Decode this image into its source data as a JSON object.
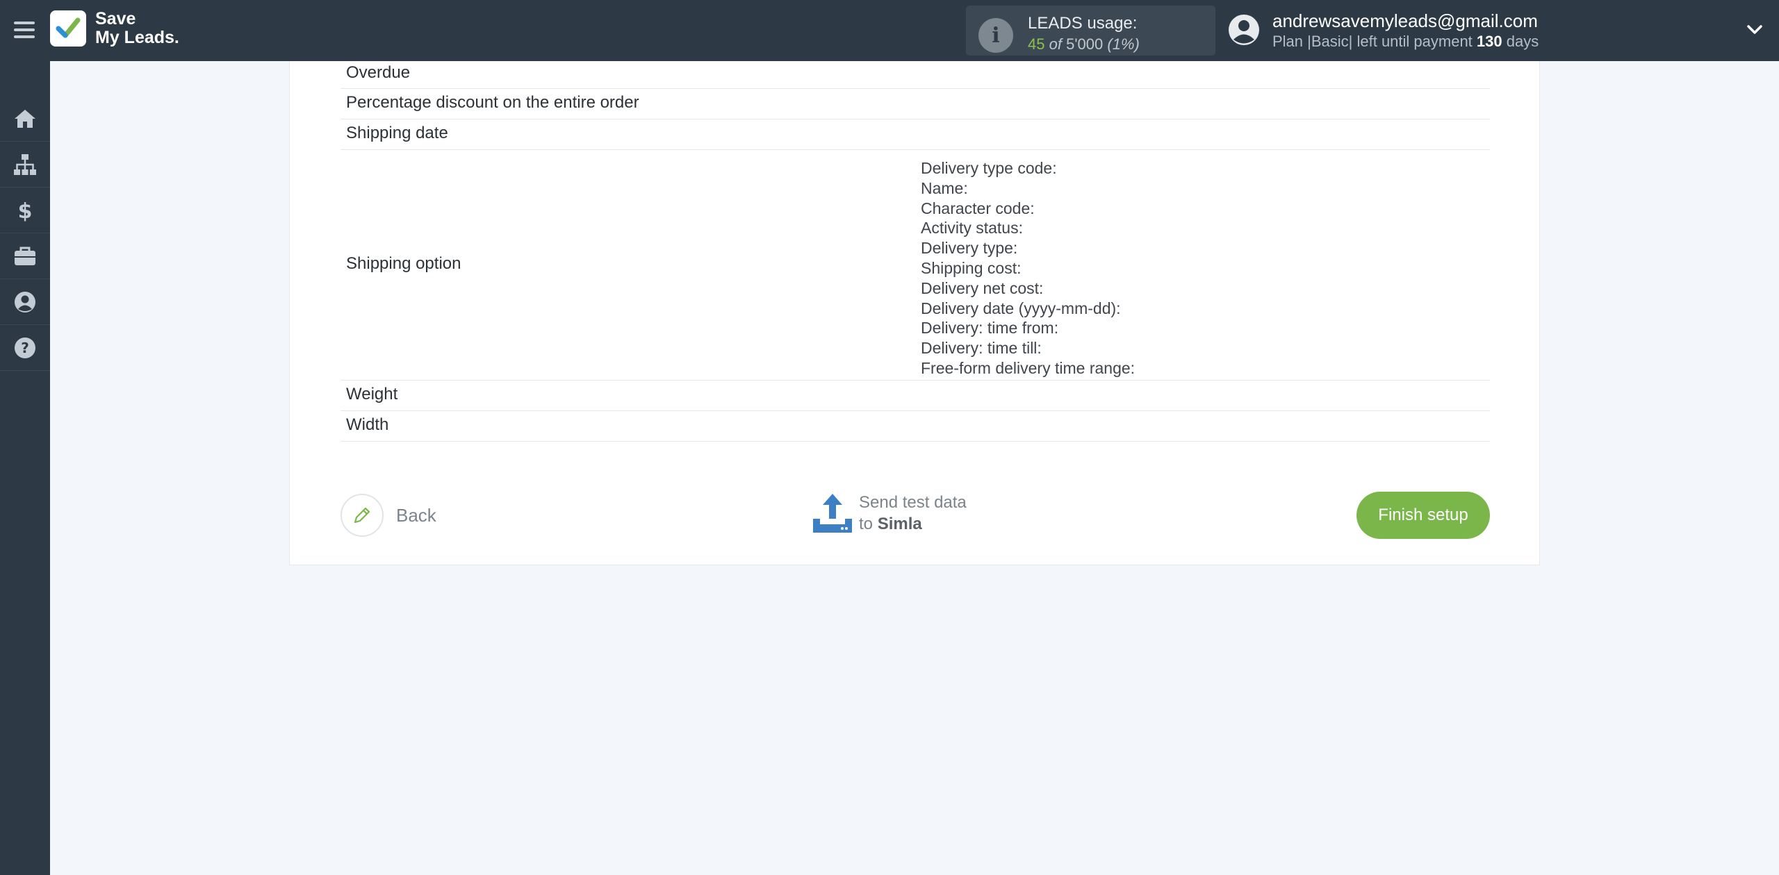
{
  "app": {
    "logo_line1": "Save",
    "logo_line2": "My Leads.",
    "brand_color": "#7bb64a"
  },
  "usage": {
    "title": "LEADS usage:",
    "used": "45",
    "of_word": "of",
    "limit": "5'000",
    "percent": "(1%)",
    "fraction": 0.01
  },
  "user": {
    "email": "andrewsavemyleads@gmail.com",
    "plan_prefix": "Plan |Basic| left until payment",
    "days": "130",
    "days_suffix": "days"
  },
  "sidebar": {
    "items": [
      {
        "icon": "home-icon"
      },
      {
        "icon": "sitemap-icon"
      },
      {
        "icon": "dollar-icon"
      },
      {
        "icon": "briefcase-icon"
      },
      {
        "icon": "user-circle-icon"
      },
      {
        "icon": "question-circle-icon"
      }
    ]
  },
  "fields": {
    "overdue": "Overdue",
    "discount": "Percentage discount on the entire order",
    "shipping_date": "Shipping date",
    "shipping_option": "Shipping option",
    "shipping_option_subfields": [
      "Delivery type code:",
      "Name:",
      "Character code:",
      "Activity status:",
      "Delivery type:",
      "Shipping cost:",
      "Delivery net cost:",
      "Delivery date (yyyy-mm-dd):",
      "Delivery: time from:",
      "Delivery: time till:",
      "Free-form delivery time range:"
    ],
    "weight": "Weight",
    "width": "Width"
  },
  "actions": {
    "back_label": "Back",
    "send_line1": "Send test data",
    "send_to": "to",
    "send_target": "Simla",
    "finish_label": "Finish setup"
  }
}
